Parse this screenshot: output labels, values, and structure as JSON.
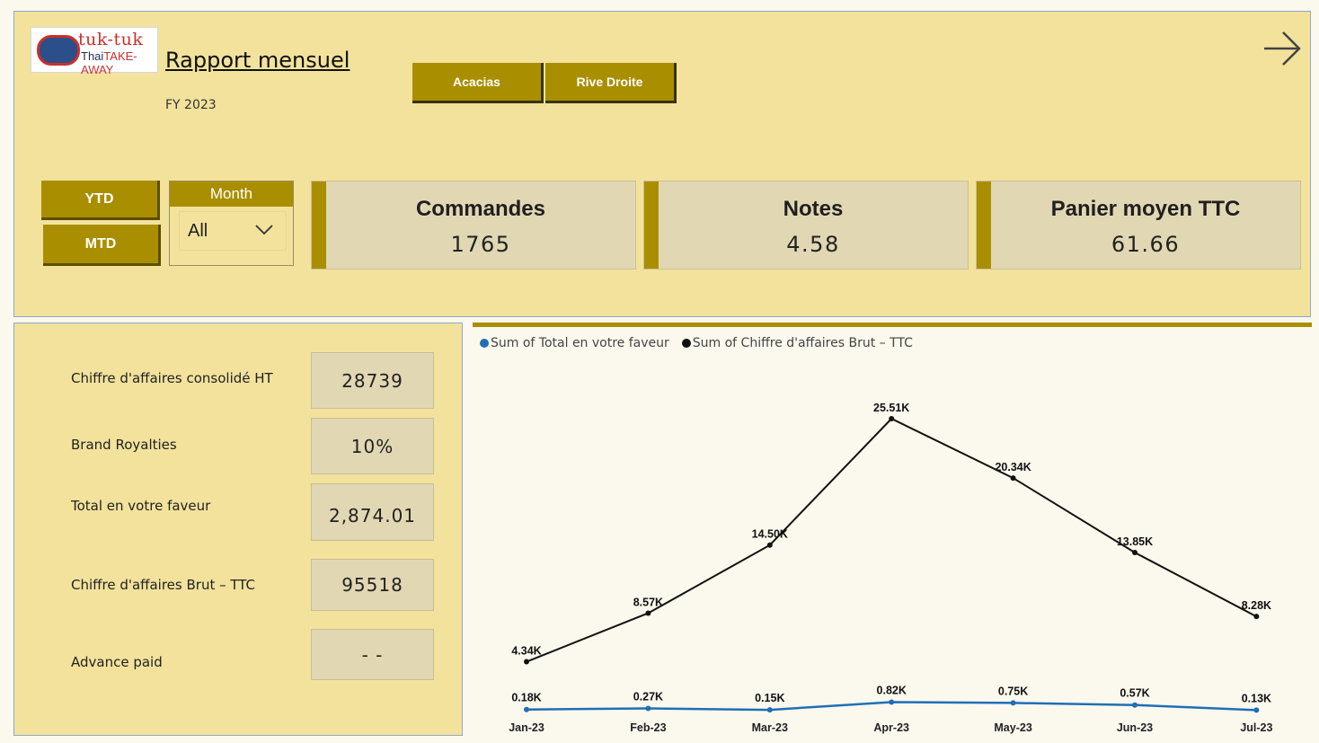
{
  "header": {
    "logo_line1": "tuk-tuk",
    "logo_line2_a": "Thai",
    "logo_line2_b": "TAKE-AWAY",
    "title": "Rapport mensuel",
    "fiscal_year": "FY 2023"
  },
  "stores": [
    "Acacias",
    "Rive Droite"
  ],
  "period_buttons": {
    "ytd": "YTD",
    "mtd": "MTD"
  },
  "month_slicer": {
    "label": "Month",
    "selected": "All"
  },
  "kpis": [
    {
      "title": "Commandes",
      "value": "1765"
    },
    {
      "title": "Notes",
      "value": "4.58"
    },
    {
      "title": "Panier moyen TTC",
      "value": "61.66"
    }
  ],
  "metrics": [
    {
      "label": "Chiffre d'affaires consolidé HT",
      "value": "28739"
    },
    {
      "label": "Brand Royalties",
      "value": "10%"
    },
    {
      "label": "Total en votre faveur",
      "value": "2,874.01"
    },
    {
      "label": "Chiffre d'affaires Brut – TTC",
      "value": "95518"
    },
    {
      "label": "Advance paid",
      "value": "- -"
    }
  ],
  "colors": {
    "accent": "#a98e00",
    "panel": "#f2e29c",
    "series_total": "#1f6fb5",
    "series_ca": "#111111"
  },
  "icons": {
    "next": "arrow-right-icon",
    "dropdown": "chevron-down-icon"
  },
  "chart_data": {
    "type": "line",
    "categories": [
      "Jan-23",
      "Feb-23",
      "Mar-23",
      "Apr-23",
      "May-23",
      "Jun-23",
      "Jul-23"
    ],
    "series": [
      {
        "name": "Sum of Total en votre faveur",
        "values": [
          0.18,
          0.27,
          0.15,
          0.82,
          0.75,
          0.57,
          0.13
        ],
        "labels": [
          "0.18K",
          "0.27K",
          "0.15K",
          "0.82K",
          "0.75K",
          "0.57K",
          "0.13K"
        ]
      },
      {
        "name": "Sum of Chiffre d'affaires Brut – TTC",
        "values": [
          4.34,
          8.57,
          14.5,
          25.51,
          20.34,
          13.85,
          8.28
        ],
        "labels": [
          "4.34K",
          "8.57K",
          "14.50K",
          "25.51K",
          "20.34K",
          "13.85K",
          "8.28K"
        ]
      }
    ],
    "ylim": [
      0,
      25.51
    ],
    "grid": false,
    "legend": "top-left"
  }
}
